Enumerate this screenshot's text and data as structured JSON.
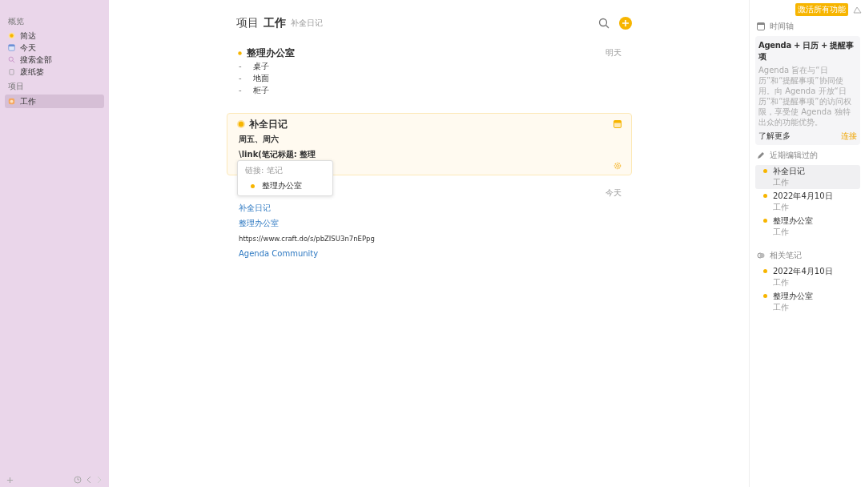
{
  "sidebar": {
    "sections": [
      {
        "heading": "概览",
        "items": [
          {
            "label": "简达",
            "kind": "sun",
            "selected": false
          },
          {
            "label": "今天",
            "kind": "calendar",
            "selected": false
          },
          {
            "label": "搜索全部",
            "kind": "search",
            "selected": false
          },
          {
            "label": "废纸篓",
            "kind": "trash",
            "selected": false
          }
        ]
      },
      {
        "heading": "项目",
        "items": [
          {
            "label": "工作",
            "kind": "project",
            "selected": true
          }
        ]
      }
    ]
  },
  "header": {
    "prefix": "项目",
    "project": "工作",
    "subtitle": "补全日记"
  },
  "notes": [
    {
      "title": "整理办公室",
      "date": "明天",
      "editing": false,
      "lines": [
        {
          "kind": "bullet",
          "marker": "-",
          "text": "桌子"
        },
        {
          "kind": "bullet",
          "marker": "-",
          "text": "地面"
        },
        {
          "kind": "bullet",
          "marker": "-",
          "text": "柜子"
        }
      ]
    },
    {
      "title": "补全日记",
      "editing": true,
      "lines": [
        {
          "kind": "text",
          "text": "周五、周六"
        },
        {
          "kind": "text",
          "text": "\\link(笔记标题: 整理"
        }
      ]
    },
    {
      "date": "今天",
      "editing": false,
      "lines": [
        {
          "kind": "link",
          "text": "补全日记"
        },
        {
          "kind": "link",
          "text": "整理办公室"
        },
        {
          "kind": "text",
          "text": "https://www.craft.do/s/pbZISU3n7nEPpg"
        },
        {
          "kind": "link",
          "text": "Agenda Community"
        }
      ]
    }
  ],
  "popup": {
    "heading": "链接: 笔记",
    "items": [
      "整理办公室"
    ]
  },
  "right": {
    "badge": "激活所有功能",
    "timeline": "时间轴",
    "card": {
      "title": "Agenda + 日历 + 提醒事项",
      "body": "Agenda 旨在与“日历”和“提醒事项”协同使用。向 Agenda 开放“日历”和“提醒事项”的访问权限，享受使 Agenda 独特出众的功能优势。",
      "more": "了解更多",
      "connect": "连接"
    },
    "recent_heading": "近期编辑过的",
    "recent": [
      {
        "title": "补全日记",
        "project": "工作",
        "selected": true
      },
      {
        "title": "2022年4月10日",
        "project": "工作",
        "selected": false
      },
      {
        "title": "整理办公室",
        "project": "工作",
        "selected": false
      }
    ],
    "related_heading": "相关笔记",
    "related": [
      {
        "title": "2022年4月10日",
        "project": "工作",
        "selected": false
      },
      {
        "title": "整理办公室",
        "project": "工作",
        "selected": false
      }
    ]
  }
}
